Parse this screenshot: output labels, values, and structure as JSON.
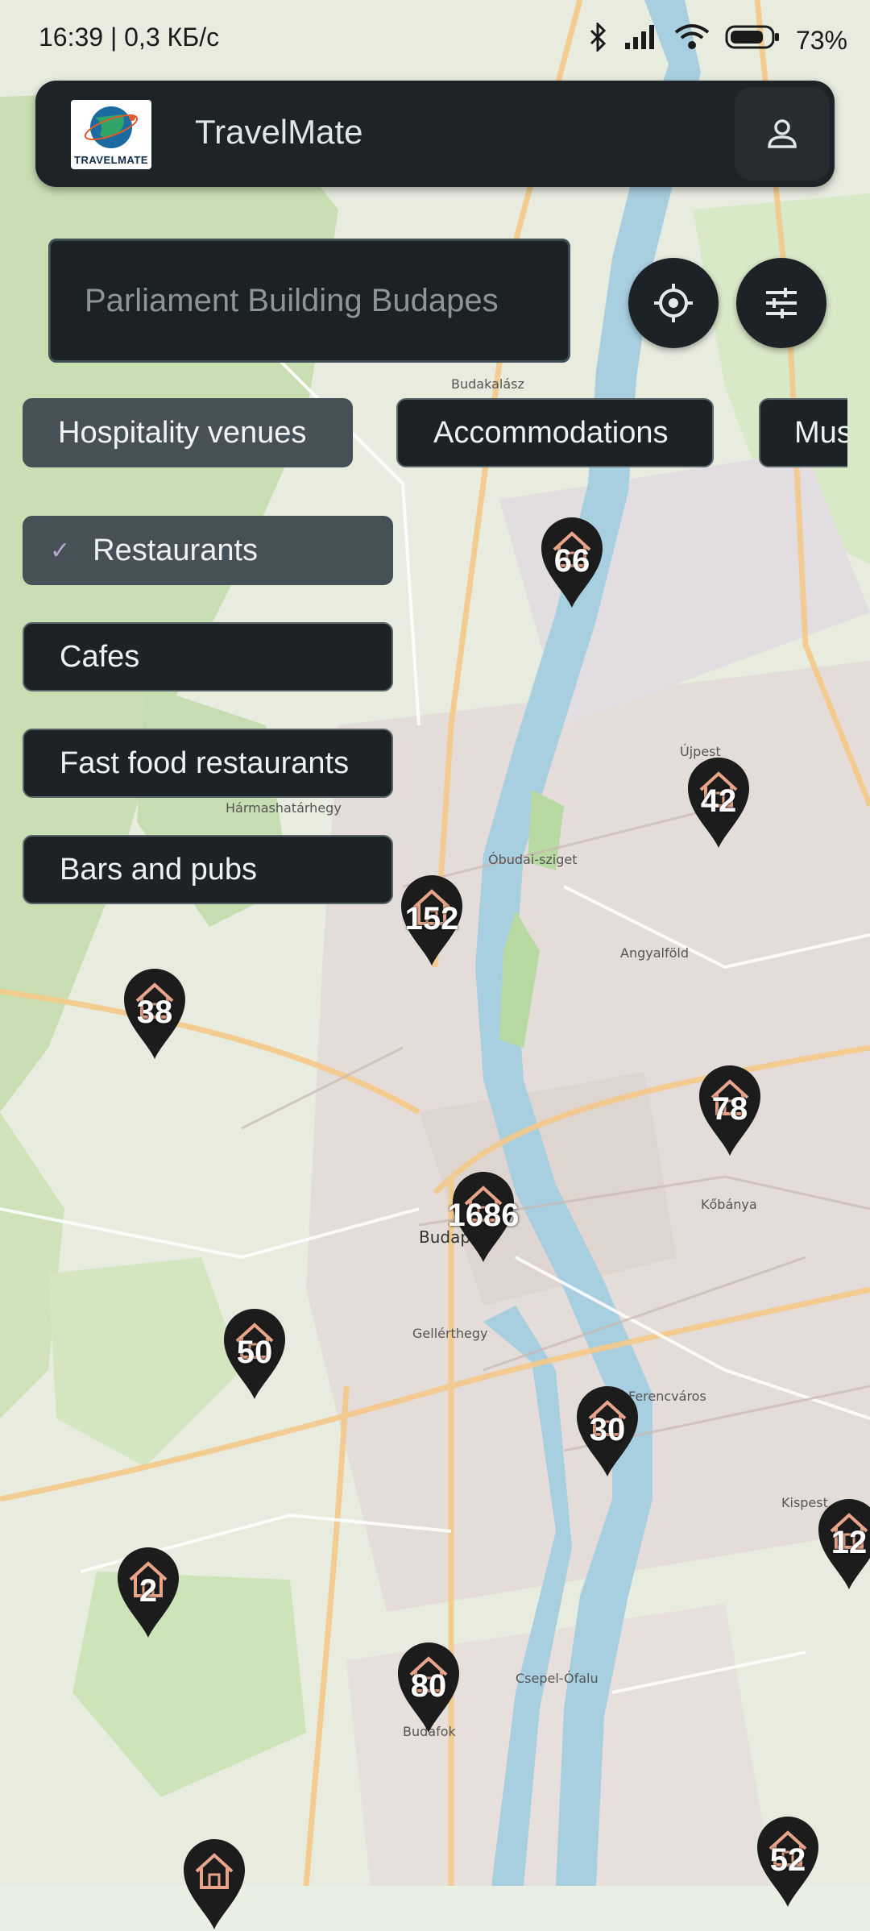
{
  "status_bar": {
    "time": "16:39 | 0,3 КБ/с",
    "battery": "73"
  },
  "app": {
    "title": "TravelMate",
    "logo_text": "TRAVELMATE"
  },
  "search": {
    "value": "Parliament Building Budapes"
  },
  "categories": [
    {
      "label": "Hospitality venues",
      "active": true
    },
    {
      "label": "Accommodations",
      "active": false
    },
    {
      "label": "Mus",
      "active": false
    }
  ],
  "subcategories": [
    {
      "label": "Restaurants",
      "selected": true
    },
    {
      "label": "Cafes",
      "selected": false
    },
    {
      "label": "Fast food restaurants",
      "selected": false
    },
    {
      "label": "Bars and pubs",
      "selected": false
    }
  ],
  "map_markers": [
    {
      "count": "66"
    },
    {
      "count": "42"
    },
    {
      "count": "152"
    },
    {
      "count": "38"
    },
    {
      "count": "78"
    },
    {
      "count": "1686"
    },
    {
      "count": "50"
    },
    {
      "count": "30"
    },
    {
      "count": "12"
    },
    {
      "count": "2"
    },
    {
      "count": "80"
    },
    {
      "count": "52"
    },
    {
      "count": ""
    }
  ],
  "map_labels": {
    "budapest": "Budapest",
    "ujpest": "Újpest",
    "hegyvidek": "Hármashatárhegy",
    "kobanya": "Kőbánya",
    "csepel": "Csepel-Ófalu",
    "budafok": "Budafok",
    "obuda": "Óbudai-sziget",
    "budakalasz": "Budakalász",
    "angyalfold": "Angyalföld",
    "ferencvaros": "Ferencváros",
    "gellerthegy": "Gellérthegy",
    "kispest": "Kispest"
  },
  "colors": {
    "panel": "#1d2326",
    "chip_active": "#465157",
    "marker": "#1c1c1c",
    "marker_house": "#e8a58a",
    "river": "#a8cfe0"
  }
}
